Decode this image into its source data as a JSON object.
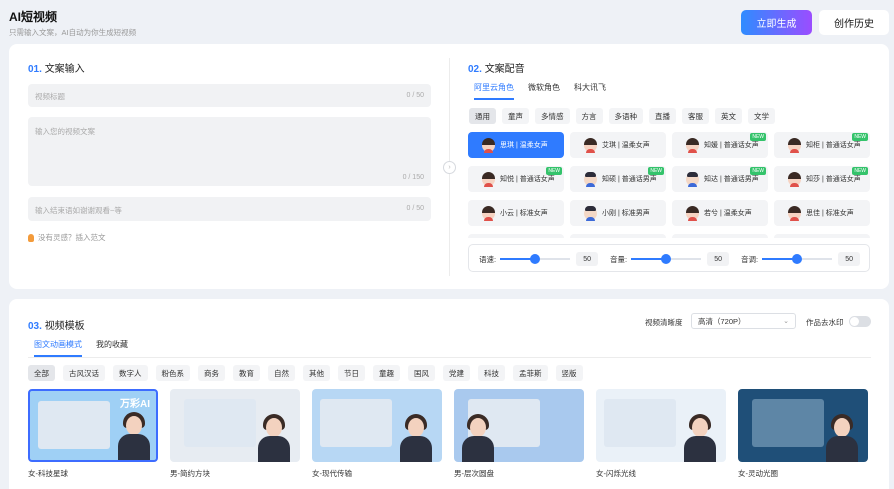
{
  "header": {
    "title": "AI短视频",
    "subtitle": "只需输入文案，AI自动为你生成短视频",
    "generate_label": "立即生成",
    "history_label": "创作历史"
  },
  "copy_section": {
    "num": "01.",
    "title": "文案输入",
    "title_field": {
      "placeholder": "视频标题",
      "count": "0 / 50"
    },
    "body_field": {
      "placeholder": "输入您的视频文案",
      "count": "0 / 150"
    },
    "ending_field": {
      "placeholder": "输入结束语如谢谢观看~等",
      "count": "0 / 50"
    },
    "tip": "没有灵感？插入范文"
  },
  "voice_section": {
    "num": "02.",
    "title": "文案配音",
    "providers": [
      "阿里云角色",
      "微软角色",
      "科大讯飞"
    ],
    "categories": [
      "通用",
      "童声",
      "多情感",
      "方言",
      "多语种",
      "直播",
      "客服",
      "英文",
      "文学"
    ],
    "voices": [
      {
        "label": "思琪 | 温柔女声",
        "gender": "f",
        "new": "",
        "active": true
      },
      {
        "label": "艾琪 | 温柔女声",
        "gender": "f",
        "new": ""
      },
      {
        "label": "知媛 | 普通话女声",
        "gender": "f",
        "new": "NEW"
      },
      {
        "label": "知柜 | 普通话女声",
        "gender": "f",
        "new": "NEW"
      },
      {
        "label": "知悦 | 普通话女声",
        "gender": "f",
        "new": "NEW"
      },
      {
        "label": "知硕 | 普通话男声",
        "gender": "m",
        "new": "NEW"
      },
      {
        "label": "知达 | 普通话男声",
        "gender": "m",
        "new": "NEW"
      },
      {
        "label": "知莎 | 普通话女声",
        "gender": "f",
        "new": "NEW"
      },
      {
        "label": "小云 | 标准女声",
        "gender": "f",
        "new": ""
      },
      {
        "label": "小刚 | 标准男声",
        "gender": "m",
        "new": ""
      },
      {
        "label": "若兮 | 温柔女声",
        "gender": "f",
        "new": ""
      },
      {
        "label": "思佳 | 标准女声",
        "gender": "f",
        "new": ""
      },
      {
        "label": "",
        "gender": "f",
        "new": ""
      },
      {
        "label": "",
        "gender": "m",
        "new": ""
      },
      {
        "label": "",
        "gender": "f",
        "new": ""
      },
      {
        "label": "",
        "gender": "f",
        "new": ""
      }
    ],
    "sliders": [
      {
        "label": "语速:",
        "value": "50",
        "level": 0.5
      },
      {
        "label": "音量:",
        "value": "50",
        "level": 0.5
      },
      {
        "label": "音调:",
        "value": "50",
        "level": 0.5
      }
    ]
  },
  "template_section": {
    "num": "03.",
    "title": "视频模板",
    "clarity_label": "视频清晰度",
    "clarity_value": "高清（720P）",
    "watermark_label": "作品去水印",
    "tabs": [
      "图文动画模式",
      "我的收藏"
    ],
    "filters": [
      "全部",
      "古风汉话",
      "数字人",
      "粉色系",
      "商务",
      "教育",
      "自然",
      "其他",
      "节日",
      "童趣",
      "国风",
      "党建",
      "科技",
      "孟菲斯",
      "竖版"
    ],
    "templates": [
      {
        "name": "女-科技星球",
        "brand": "万彩AI",
        "bg": "#9fd0f5"
      },
      {
        "name": "男-简约方块",
        "brand": "",
        "bg": "#e7ecf2"
      },
      {
        "name": "女-现代传输",
        "brand": "",
        "bg": "#b7d7f4"
      },
      {
        "name": "男-层次圆盘",
        "brand": "",
        "bg": "#a9c9ee"
      },
      {
        "name": "女-闪烁光线",
        "brand": "",
        "bg": "#eaf1f8"
      },
      {
        "name": "女-灵动光圈",
        "brand": "",
        "bg": "#1f4f78"
      }
    ]
  },
  "colors": {
    "accent": "#2f7bff",
    "gradient_start": "#2f8cff",
    "gradient_end": "#9b4dff"
  }
}
